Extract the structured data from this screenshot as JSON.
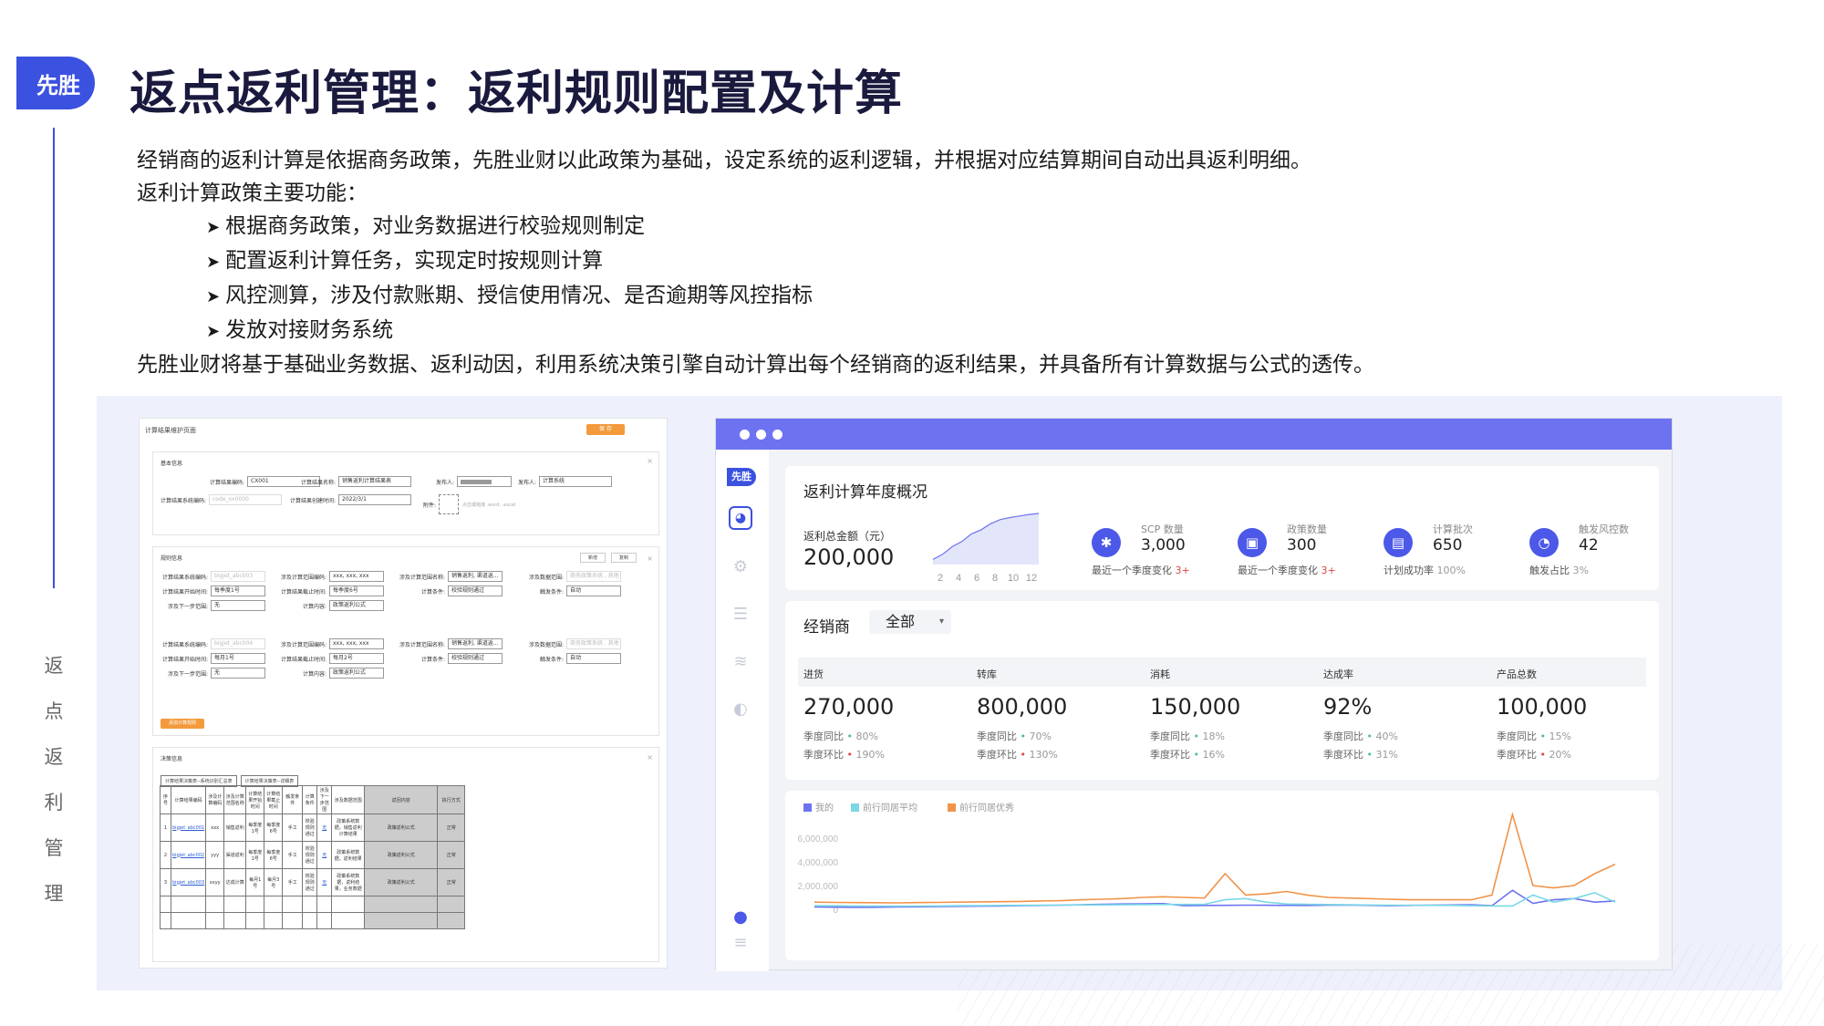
{
  "header": {
    "logo": "先胜",
    "title": "返点返利管理：返利规则配置及计算"
  },
  "side_label": [
    "返",
    "点",
    "返",
    "利",
    "管",
    "理"
  ],
  "intro": {
    "line1": "经销商的返利计算是依据商务政策，先胜业财以此政策为基础，设定系统的返利逻辑，并根据对应结算期间自动出具返利明细。",
    "line2": "返利计算政策主要功能：",
    "bullets": [
      "根据商务政策，对业务数据进行校验规则制定",
      "配置返利计算任务，实现定时按规则计算",
      "风控测算，涉及付款账期、授信使用情况、是否逾期等风控指标",
      "发放对接财务系统"
    ],
    "line3": "先胜业财将基于基础业务数据、返利动因，利用系统决策引擎自动计算出每个经销商的返利结果，并具备所有计算数据与公式的透传。"
  },
  "form": {
    "page_title": "计算结果维护页面",
    "top_button": "保 存",
    "basic": {
      "title": "基本信息",
      "rows": [
        {
          "label": "计算结果编码:",
          "value": "CX001"
        },
        {
          "label": "计算结果名称:",
          "value": "销售返利计算结果表"
        },
        {
          "label": "发布人:",
          "value": ""
        },
        {
          "label": "发布人:",
          "value": "计算系统"
        },
        {
          "label": "计算结果系统编码:",
          "value": "code_xx0000"
        },
        {
          "label": "计算结果创建时间:",
          "value": "2022/3/1"
        },
        {
          "label": "附件:",
          "value": "点击或拖拽 .word, .excel"
        }
      ]
    },
    "rules": {
      "title": "规则信息",
      "btn1": "新增",
      "btn2": "复制",
      "fields": [
        {
          "label": "计算结果系统编码:",
          "value": "bigjet_abc003"
        },
        {
          "label": "涉及计算范围编码:",
          "value": "xxx, xxx, xxx"
        },
        {
          "label": "涉及计算范围名称:",
          "value": "销售返利, 渠道返..."
        },
        {
          "label": "涉及数据范围:",
          "value": "商务政策系统 , 其他"
        },
        {
          "label": "计算结果开始时间:",
          "value": "每季度1号"
        },
        {
          "label": "计算结果截止时间:",
          "value": "每季度6号"
        },
        {
          "label": "计算条件:",
          "value": "校验规则通过"
        },
        {
          "label": "触发条件:",
          "value": "自动"
        },
        {
          "label": "涉及下一步范围:",
          "value": "无"
        },
        {
          "label": "计算内容:",
          "value": "政策返利公式"
        },
        {
          "label": "计算结果系统编码:",
          "value": "bigjet_abc004"
        },
        {
          "label": "涉及计算范围编码:",
          "value": "xxx, xxx, xxx"
        },
        {
          "label": "涉及计算范围名称:",
          "value": "销售返利, 渠道返..."
        },
        {
          "label": "涉及数据范围:",
          "value": "商务政策系统 , 其他"
        },
        {
          "label": "计算结果开始时间:",
          "value": "每月1号"
        },
        {
          "label": "计算结果截止时间:",
          "value": "每月2号"
        },
        {
          "label": "计算条件:",
          "value": "校验规则通过"
        },
        {
          "label": "触发条件:",
          "value": "自动"
        },
        {
          "label": "涉及下一步范围:",
          "value": "无"
        },
        {
          "label": "计算内容:",
          "value": "政策返利公式"
        }
      ],
      "add_btn": "添加计算规则"
    },
    "result": {
      "title": "决策信息",
      "tab1": "计算结果决策表--系统识别汇总表",
      "tab2": "计算结果决策表--详细表",
      "cols": [
        "序号",
        "计算结果编码",
        "涉及计算编码",
        "涉及计算范围名称",
        "计算结果开始时间",
        "计算结果截止时间",
        "触发条件",
        "计算条件",
        "涉及下一步范围",
        "涉及数据范围",
        "返回内容",
        "执行方式"
      ],
      "rows": [
        [
          "1",
          "bigjet_abc001",
          "xxx",
          "销售返利",
          "每季度1号",
          "每季度6号",
          "手工",
          "校验规则通过",
          "无",
          "政策系统数据，销售返利计算结果",
          "政策返利公式",
          "正常"
        ],
        [
          "2",
          "bigjet_abc002",
          "yyy",
          "渠道返利",
          "每季度1号",
          "每季度6号",
          "手工",
          "校验规则通过",
          "无",
          "政策系统数据，返利结果",
          "政策返利公式",
          "正常"
        ],
        [
          "3",
          "bigjet_abc003",
          "xxyy",
          "达成计算",
          "每月1号",
          "每月3号",
          "手工",
          "校验规则通过",
          "无",
          "政策系统数据，返利结果，业务数据",
          "政策返利公式",
          "正常"
        ]
      ]
    }
  },
  "dashboard": {
    "logo": "先胜",
    "overview": {
      "title": "返利计算年度概况",
      "total_label": "返利总金额（元）",
      "total_value": "200,000",
      "spark_ticks": [
        "2",
        "4",
        "6",
        "8",
        "10",
        "12"
      ],
      "stats": [
        {
          "icon": "scp-icon",
          "name": "SCP 数量",
          "value": "3,000",
          "sub": "最近一个季度变化",
          "delta": "3+"
        },
        {
          "icon": "policy-icon",
          "name": "政策数量",
          "value": "300",
          "sub": "最近一个季度变化",
          "delta": "3+"
        },
        {
          "icon": "batch-icon",
          "name": "计算批次",
          "value": "650",
          "sub": "计划成功率",
          "delta": "100%"
        },
        {
          "icon": "risk-icon",
          "name": "触发风控数",
          "value": "42",
          "sub": "触发占比",
          "delta": "3%"
        }
      ]
    },
    "dealer": {
      "title": "经销商",
      "select": "全部",
      "metrics": [
        {
          "name": "进货",
          "value": "270,000",
          "q_label": "季度同比",
          "q": "80%",
          "q_dir": "up",
          "m_label": "季度环比",
          "m": "190%",
          "m_dir": "down"
        },
        {
          "name": "转库",
          "value": "800,000",
          "q_label": "季度同比",
          "q": "70%",
          "q_dir": "up",
          "m_label": "季度环比",
          "m": "130%",
          "m_dir": "down"
        },
        {
          "name": "消耗",
          "value": "150,000",
          "q_label": "季度同比",
          "q": "18%",
          "q_dir": "up",
          "m_label": "季度环比",
          "m": "16%",
          "m_dir": "up"
        },
        {
          "name": "达成率",
          "value": "92%",
          "q_label": "季度同比",
          "q": "40%",
          "q_dir": "up",
          "m_label": "季度环比",
          "m": "31%",
          "m_dir": "up"
        },
        {
          "name": "产品总数",
          "value": "100,000",
          "q_label": "季度同比",
          "q": "15%",
          "q_dir": "up",
          "m_label": "季度环比",
          "m": "20%",
          "m_dir": "down"
        }
      ]
    },
    "trend": {
      "legend": [
        "我的",
        "前行同居平均",
        "前行同居优秀"
      ],
      "colors": [
        "#6d73f0",
        "#7ad8e6",
        "#f0944a"
      ],
      "yticks": [
        "6,000,000",
        "4,000,000",
        "2,000,000",
        "0"
      ]
    }
  },
  "chart_data": [
    {
      "type": "area",
      "x": [
        1,
        2,
        3,
        4,
        5,
        6,
        7,
        8,
        9,
        10,
        11,
        12
      ],
      "values": [
        10,
        20,
        35,
        45,
        60,
        68,
        80,
        88,
        92,
        95,
        98,
        100
      ],
      "xticks": [
        "2",
        "4",
        "6",
        "8",
        "10",
        "12"
      ]
    },
    {
      "type": "line",
      "ylim": [
        0,
        6000000
      ],
      "series": [
        {
          "name": "我的",
          "color": "#6d73f0",
          "values": [
            200000,
            180000,
            160000,
            170000,
            200000,
            210000,
            220000,
            250000,
            260000,
            280000,
            300000,
            320000,
            350000,
            380000,
            420000,
            450000,
            460000,
            480000,
            300000,
            320000,
            330000,
            350000,
            340000,
            330000,
            320000,
            350000,
            360000,
            330000,
            300000,
            320000,
            350000,
            360000,
            380000,
            300000,
            1600000,
            500000,
            800000,
            900000,
            600000,
            700000
          ]
        },
        {
          "name": "前行同居平均",
          "color": "#7ad8e6",
          "values": [
            300000,
            290000,
            280000,
            270000,
            260000,
            270000,
            280000,
            300000,
            310000,
            320000,
            330000,
            340000,
            350000,
            360000,
            370000,
            380000,
            390000,
            400000,
            410000,
            420000,
            800000,
            900000,
            600000,
            450000,
            420000,
            400000,
            380000,
            360000,
            350000,
            340000,
            330000,
            320000,
            300000,
            280000,
            280000,
            1200000,
            600000,
            900000,
            1400000,
            600000
          ]
        },
        {
          "name": "前行同居优秀",
          "color": "#f0944a",
          "values": [
            600000,
            580000,
            560000,
            550000,
            540000,
            560000,
            580000,
            600000,
            620000,
            640000,
            660000,
            700000,
            720000,
            800000,
            850000,
            900000,
            1000000,
            1050000,
            1000000,
            950000,
            3000000,
            1200000,
            1300000,
            1500000,
            1200000,
            1000000,
            950000,
            900000,
            850000,
            800000,
            800000,
            800000,
            800000,
            1200000,
            8000000,
            2000000,
            1800000,
            2000000,
            3000000,
            3800000
          ]
        }
      ]
    }
  ]
}
